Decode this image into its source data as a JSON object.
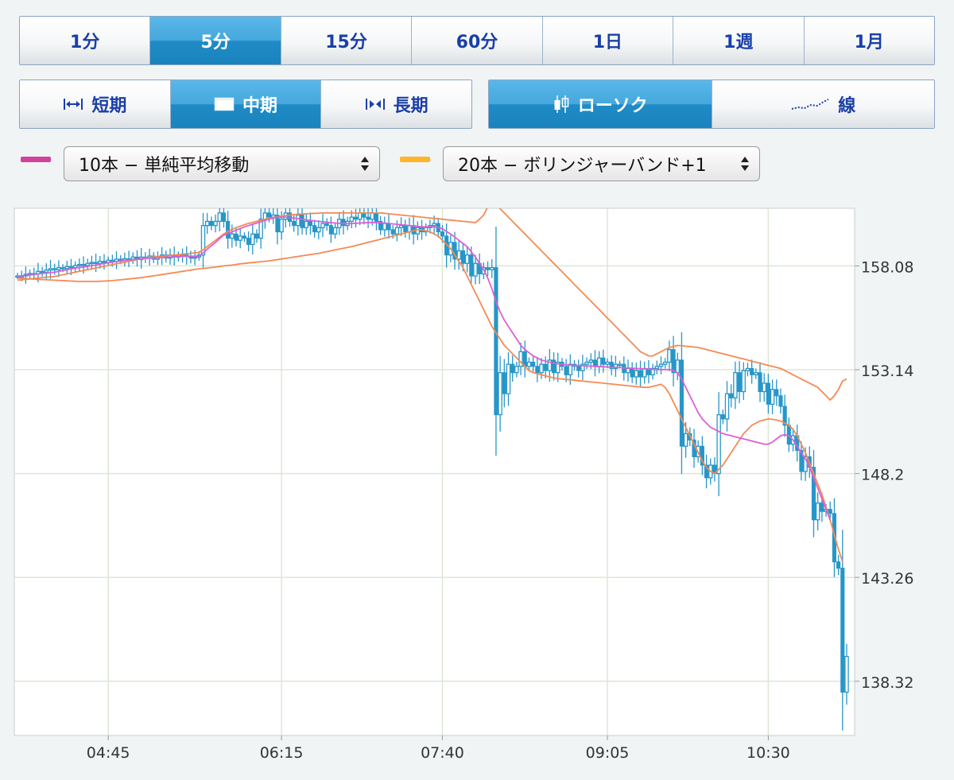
{
  "timeframes": [
    {
      "label": "1分",
      "active": false
    },
    {
      "label": "5分",
      "active": true
    },
    {
      "label": "15分",
      "active": false
    },
    {
      "label": "60分",
      "active": false
    },
    {
      "label": "1日",
      "active": false
    },
    {
      "label": "1週",
      "active": false
    },
    {
      "label": "1月",
      "active": false
    }
  ],
  "periods": [
    {
      "label": "短期",
      "icon": "arrows-apart-icon",
      "active": false
    },
    {
      "label": "中期",
      "icon": "window-icon",
      "active": true
    },
    {
      "label": "長期",
      "icon": "arrows-together-icon",
      "active": false
    }
  ],
  "chart_types": [
    {
      "label": "ローソク",
      "icon": "candlestick-icon",
      "active": true
    },
    {
      "label": "線",
      "icon": "line-chart-icon",
      "active": false
    }
  ],
  "indicators": {
    "ma": {
      "label": "10本 − 単純平均移動",
      "color": "#d1439a"
    },
    "bb": {
      "label": "20本 − ボリンジャーバンド+1",
      "color": "#ffb52a"
    }
  },
  "colors": {
    "candle": "#2796c8",
    "ma": "#dd5fd6",
    "band": "#f58a55",
    "grid": "#dde7d4"
  },
  "chart_data": {
    "type": "candlestick",
    "y_ticks": [
      "158.08",
      "153.14",
      "148.2",
      "143.26",
      "138.32"
    ],
    "x_ticks": [
      "04:45",
      "06:15",
      "07:40",
      "09:05",
      "10:30"
    ],
    "y_tick_values": [
      158.08,
      153.14,
      148.2,
      143.26,
      138.32
    ],
    "ylim": [
      135.74,
      160.82
    ],
    "x_tick_index": [
      22,
      64,
      103,
      143,
      182
    ],
    "grid": true,
    "close": [
      157.6,
      157.6,
      157.68,
      157.72,
      157.7,
      157.82,
      157.78,
      157.88,
      157.95,
      157.9,
      158.0,
      157.95,
      158.05,
      158.0,
      158.1,
      158.15,
      158.1,
      158.2,
      158.25,
      158.2,
      158.3,
      158.25,
      158.35,
      158.3,
      158.4,
      158.35,
      158.42,
      158.4,
      158.5,
      158.38,
      158.5,
      158.45,
      158.55,
      158.4,
      158.5,
      158.6,
      158.45,
      158.6,
      158.5,
      158.55,
      158.6,
      158.55,
      158.45,
      158.5,
      158.6,
      160.0,
      160.2,
      160.0,
      160.2,
      160.6,
      160.2,
      159.4,
      159.6,
      159.3,
      159.5,
      159.4,
      159.1,
      159.6,
      159.4,
      160.3,
      160.6,
      160.4,
      160.5,
      159.7,
      160.3,
      160.6,
      160.2,
      160.0,
      160.5,
      159.9,
      160.2,
      160.0,
      159.7,
      159.9,
      160.1,
      160.0,
      159.6,
      159.9,
      160.3,
      160.0,
      160.2,
      160.4,
      160.3,
      160.6,
      160.4,
      160.3,
      160.6,
      160.2,
      159.8,
      160.1,
      159.8,
      159.6,
      159.9,
      160.0,
      159.7,
      160.0,
      159.6,
      159.9,
      159.7,
      159.9,
      160.0,
      160.1,
      159.7,
      159.5,
      158.6,
      159.2,
      158.4,
      158.8,
      158.2,
      158.6,
      157.6,
      158.2,
      157.7,
      158.0,
      157.9,
      158.0,
      151.0,
      153.0,
      152.0,
      153.4,
      153.0,
      153.3,
      154.0,
      153.3,
      153.5,
      153.3,
      153.0,
      153.4,
      153.1,
      153.6,
      153.0,
      153.5,
      153.3,
      152.9,
      153.4,
      153.3,
      153.1,
      153.4,
      153.5,
      153.6,
      153.3,
      153.7,
      153.4,
      153.5,
      153.2,
      153.4,
      153.4,
      153.0,
      153.2,
      152.8,
      153.1,
      152.8,
      153.2,
      152.9,
      153.2,
      153.3,
      153.4,
      153.5,
      154.1,
      153.0,
      153.6,
      149.5,
      150.1,
      149.8,
      149.0,
      149.5,
      148.6,
      148.0,
      148.6,
      148.2,
      151.0,
      150.8,
      152.0,
      151.8,
      153.0,
      152.1,
      153.1,
      153.2,
      152.9,
      153.0,
      152.1,
      152.5,
      151.5,
      152.2,
      151.9,
      151.4,
      150.5,
      149.6,
      150.0,
      149.3,
      148.3,
      149.0,
      148.5,
      146.0,
      146.8,
      146.4,
      146.5,
      146.3,
      144.0,
      143.7,
      137.8,
      139.5
    ],
    "ma": [
      157.6,
      157.61,
      157.63,
      157.65,
      157.67,
      157.7,
      157.72,
      157.74,
      157.76,
      157.78,
      157.82,
      157.86,
      157.9,
      157.94,
      157.97,
      158.0,
      158.03,
      158.06,
      158.1,
      158.12,
      158.16,
      158.2,
      158.23,
      158.26,
      158.29,
      158.31,
      158.34,
      158.36,
      158.38,
      158.4,
      158.42,
      158.44,
      158.45,
      158.46,
      158.47,
      158.48,
      158.49,
      158.5,
      158.51,
      158.52,
      158.53,
      158.54,
      158.54,
      158.54,
      158.55,
      158.7,
      158.88,
      159.04,
      159.2,
      159.38,
      159.55,
      159.62,
      159.7,
      159.78,
      159.86,
      159.94,
      160.0,
      160.06,
      160.12,
      160.18,
      160.24,
      160.3,
      160.36,
      160.4,
      160.4,
      160.4,
      160.38,
      160.36,
      160.33,
      160.3,
      160.27,
      160.25,
      160.22,
      160.2,
      160.18,
      160.16,
      160.14,
      160.12,
      160.11,
      160.1,
      160.09,
      160.1,
      160.11,
      160.12,
      160.13,
      160.14,
      160.15,
      160.14,
      160.13,
      160.12,
      160.1,
      160.08,
      160.06,
      160.04,
      160.02,
      160.0,
      159.98,
      159.96,
      159.94,
      159.94,
      159.94,
      159.94,
      159.9,
      159.85,
      159.72,
      159.6,
      159.45,
      159.3,
      159.15,
      159.0,
      158.75,
      158.5,
      158.2,
      157.9,
      157.5,
      157.0,
      156.4,
      155.9,
      155.5,
      155.2,
      154.9,
      154.6,
      154.3,
      154.1,
      153.95,
      153.8,
      153.7,
      153.6,
      153.55,
      153.5,
      153.45,
      153.42,
      153.4,
      153.38,
      153.36,
      153.35,
      153.34,
      153.33,
      153.32,
      153.31,
      153.3,
      153.29,
      153.28,
      153.27,
      153.26,
      153.25,
      153.24,
      153.23,
      153.22,
      153.21,
      153.2,
      153.19,
      153.18,
      153.17,
      153.16,
      153.15,
      153.15,
      153.15,
      153.15,
      153.1,
      153.0,
      152.7,
      152.3,
      151.9,
      151.5,
      151.1,
      150.8,
      150.6,
      150.4,
      150.3,
      150.2,
      150.1,
      150.05,
      150.0,
      149.95,
      149.9,
      149.85,
      149.8,
      149.75,
      149.7,
      149.65,
      149.6,
      149.6,
      149.7,
      149.85,
      150.0,
      150.05,
      150.0,
      149.8,
      149.5,
      149.2,
      148.9,
      148.5,
      148.0,
      147.5,
      147.0,
      146.5,
      146.0
    ],
    "band_upper": [
      157.4,
      157.42,
      157.44,
      157.46,
      157.48,
      157.5,
      157.52,
      157.54,
      157.56,
      157.58,
      157.62,
      157.66,
      157.7,
      157.74,
      157.78,
      157.82,
      157.86,
      157.9,
      157.94,
      157.98,
      158.02,
      158.06,
      158.1,
      158.14,
      158.18,
      158.22,
      158.26,
      158.3,
      158.34,
      158.38,
      158.42,
      158.45,
      158.48,
      158.5,
      158.52,
      158.54,
      158.56,
      158.58,
      158.6,
      158.62,
      158.64,
      158.66,
      158.68,
      158.7,
      158.72,
      158.85,
      159.0,
      159.15,
      159.3,
      159.45,
      159.6,
      159.72,
      159.82,
      159.9,
      159.97,
      160.04,
      160.1,
      160.15,
      160.2,
      160.25,
      160.3,
      160.34,
      160.38,
      160.42,
      160.45,
      160.48,
      160.5,
      160.52,
      160.54,
      160.55,
      160.56,
      160.57,
      160.58,
      160.59,
      160.6,
      160.6,
      160.6,
      160.6,
      160.6,
      160.6,
      160.6,
      160.6,
      160.6,
      160.6,
      160.6,
      160.6,
      160.6,
      160.6,
      160.6,
      160.58,
      160.56,
      160.54,
      160.52,
      160.5,
      160.48,
      160.46,
      160.44,
      160.42,
      160.4,
      160.38,
      160.36,
      160.34,
      160.32,
      160.3,
      160.28,
      160.26,
      160.24,
      160.22,
      160.2,
      160.18,
      160.16,
      160.14,
      160.3,
      160.5,
      160.9,
      161.3,
      161.0,
      160.8,
      160.6,
      160.4,
      160.2,
      160.0,
      159.8,
      159.6,
      159.4,
      159.2,
      159.0,
      158.8,
      158.6,
      158.4,
      158.2,
      158.0,
      157.8,
      157.6,
      157.4,
      157.2,
      157.0,
      156.8,
      156.6,
      156.4,
      156.2,
      156.0,
      155.8,
      155.6,
      155.4,
      155.2,
      155.0,
      154.8,
      154.6,
      154.4,
      154.2,
      154.0,
      153.9,
      153.8,
      153.8,
      153.9,
      154.0,
      154.1,
      154.2,
      154.25,
      154.3,
      154.28,
      154.26,
      154.24,
      154.22,
      154.2,
      154.15,
      154.1,
      154.05,
      154.0,
      153.95,
      153.9,
      153.85,
      153.8,
      153.75,
      153.7,
      153.65,
      153.6,
      153.55,
      153.5,
      153.45,
      153.4,
      153.35,
      153.3,
      153.25,
      153.2,
      153.1,
      153.0,
      152.9,
      152.8,
      152.7,
      152.6,
      152.5,
      152.4,
      152.3,
      152.1,
      151.9,
      151.7,
      151.9,
      152.2,
      152.6,
      152.7
    ],
    "band_lower": [
      157.5,
      157.5,
      157.48,
      157.46,
      157.45,
      157.44,
      157.43,
      157.42,
      157.41,
      157.4,
      157.39,
      157.38,
      157.37,
      157.36,
      157.35,
      157.34,
      157.34,
      157.34,
      157.34,
      157.34,
      157.35,
      157.36,
      157.37,
      157.38,
      157.4,
      157.42,
      157.44,
      157.46,
      157.48,
      157.5,
      157.52,
      157.55,
      157.58,
      157.61,
      157.64,
      157.67,
      157.7,
      157.73,
      157.76,
      157.79,
      157.82,
      157.85,
      157.88,
      157.91,
      157.94,
      157.96,
      157.98,
      158.0,
      158.02,
      158.05,
      158.08,
      158.1,
      158.12,
      158.15,
      158.18,
      158.2,
      158.22,
      158.24,
      158.26,
      158.28,
      158.3,
      158.32,
      158.35,
      158.38,
      158.41,
      158.44,
      158.47,
      158.5,
      158.53,
      158.56,
      158.59,
      158.62,
      158.65,
      158.68,
      158.72,
      158.76,
      158.8,
      158.84,
      158.88,
      158.92,
      158.96,
      159.0,
      159.05,
      159.1,
      159.15,
      159.2,
      159.25,
      159.3,
      159.35,
      159.4,
      159.45,
      159.5,
      159.55,
      159.6,
      159.65,
      159.7,
      159.75,
      159.8,
      159.8,
      159.75,
      159.7,
      159.6,
      159.5,
      159.3,
      159.1,
      158.9,
      158.6,
      158.3,
      158.0,
      157.6,
      157.2,
      156.8,
      156.4,
      156.0,
      155.6,
      155.2,
      154.9,
      154.6,
      154.3,
      154.1,
      153.9,
      153.7,
      153.5,
      153.3,
      153.1,
      153.0,
      152.95,
      152.9,
      152.85,
      152.8,
      152.75,
      152.72,
      152.7,
      152.68,
      152.66,
      152.64,
      152.62,
      152.6,
      152.58,
      152.56,
      152.54,
      152.52,
      152.5,
      152.48,
      152.46,
      152.44,
      152.42,
      152.4,
      152.38,
      152.36,
      152.34,
      152.32,
      152.3,
      152.3,
      152.35,
      152.4,
      152.45,
      152.3,
      152.0,
      151.6,
      151.2,
      150.8,
      150.4,
      150.0,
      149.6,
      149.2,
      148.8,
      148.5,
      148.3,
      148.2,
      148.4,
      148.6,
      148.9,
      149.2,
      149.5,
      149.8,
      150.1,
      150.3,
      150.5,
      150.6,
      150.7,
      150.75,
      150.8,
      150.78,
      150.75,
      150.7,
      150.6,
      150.5,
      150.3,
      150.0,
      149.6,
      149.2,
      148.7,
      148.2,
      147.7,
      147.2,
      146.6,
      146.0,
      145.3,
      144.6,
      144.0
    ]
  }
}
